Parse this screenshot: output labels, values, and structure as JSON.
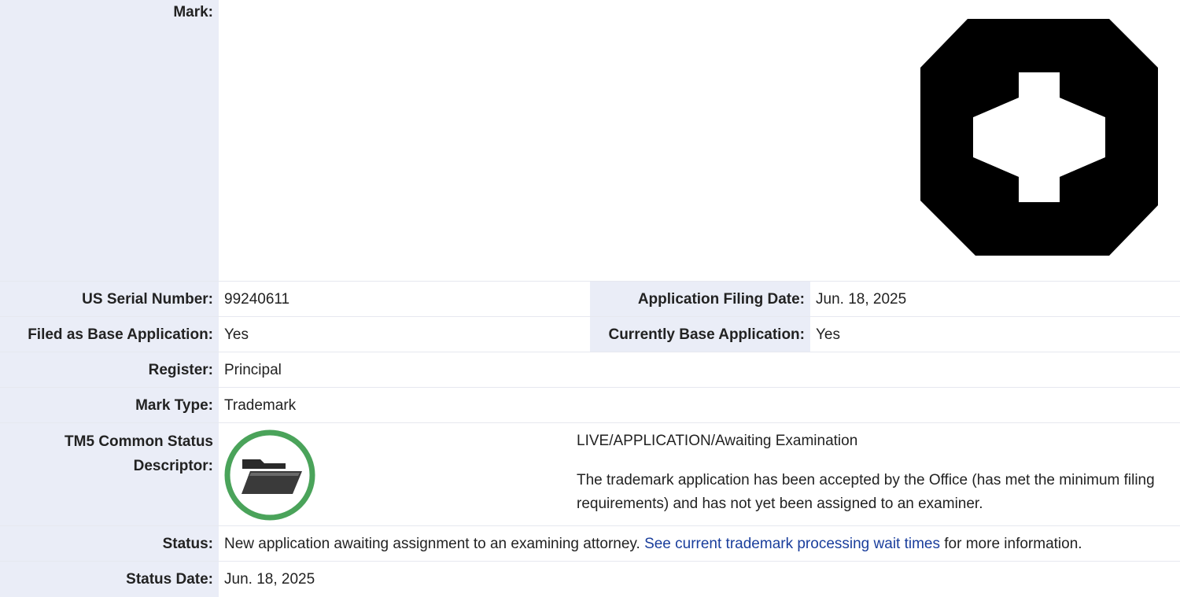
{
  "mark": {
    "label": "Mark:",
    "image_icon": "octagon-ring-mark-icon"
  },
  "serial": {
    "label": "US Serial Number:",
    "value": "99240611",
    "filing_label": "Application Filing Date:",
    "filing_value": "Jun. 18, 2025"
  },
  "base": {
    "label": "Filed as Base Application:",
    "value": "Yes",
    "current_label": "Currently Base Application:",
    "current_value": "Yes"
  },
  "register": {
    "label": "Register:",
    "value": "Principal"
  },
  "mark_type": {
    "label": "Mark Type:",
    "value": "Trademark"
  },
  "tm5": {
    "label_line1": "TM5 Common Status",
    "label_line2": "Descriptor:",
    "icon": "open-folder-icon",
    "ring_color": "#4aa35a",
    "status_line": "LIVE/APPLICATION/Awaiting Examination",
    "description": "The trademark application has been accepted by the Office (has met the minimum filing requirements) and has not yet been assigned to an examiner."
  },
  "status": {
    "label": "Status:",
    "text_before": "New application awaiting assignment to an examining attorney. ",
    "link_text": "See current trademark processing wait times",
    "text_after": " for more information."
  },
  "status_date": {
    "label": "Status Date:",
    "value": "Jun. 18, 2025"
  }
}
